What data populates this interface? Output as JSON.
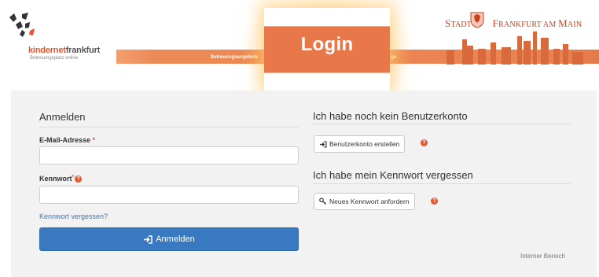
{
  "header": {
    "logo": {
      "brand_a": "kindernet",
      "brand_b": "frankfurt",
      "tagline": "Betreuungsplatz online"
    },
    "nav_left": "Betreuungsangebote",
    "nav_right": "ge",
    "login_title": "Login",
    "city": {
      "w1": "S",
      "w1b": "TADT",
      "w2": "F",
      "w2b": "RANKFURT AM ",
      "w3": "M",
      "w3b": "AIN"
    }
  },
  "login_section": {
    "title": "Anmelden",
    "email_label": "E-Mail-Adresse",
    "required_mark": "*",
    "email_value": "",
    "password_label": "Kennwort",
    "password_value": "",
    "forgot_link": "Kennwort vergessen?",
    "submit_label": "Anmelden"
  },
  "register_section": {
    "title": "Ich habe noch kein Benutzerkonto",
    "button_label": "Benutzerkonto erstellen"
  },
  "forgot_section": {
    "title": "Ich habe mein Kennwort vergessen",
    "button_label": "Neues Kennwort anfordern"
  },
  "footer": {
    "internal_link": "Interner Bereich"
  },
  "help_glyph": "?",
  "colors": {
    "accent_orange": "#e8784a",
    "primary_blue": "#3879c1",
    "help_red": "#e8542b",
    "link_blue": "#3a75b5"
  }
}
